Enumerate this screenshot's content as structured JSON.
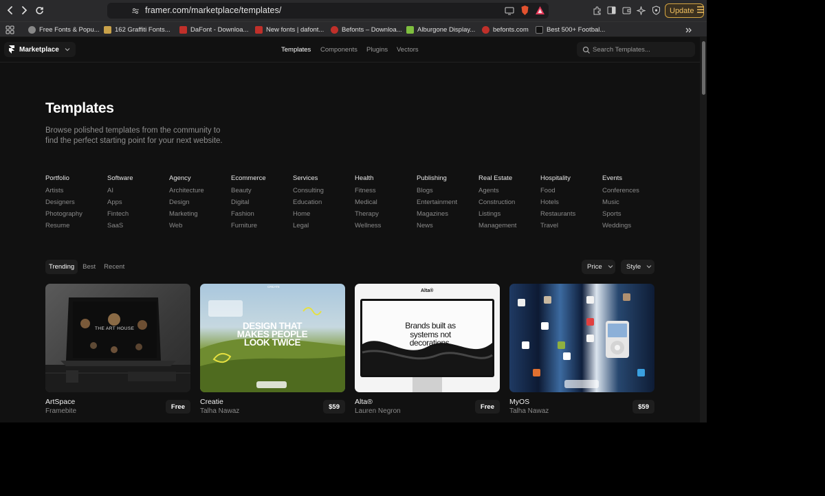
{
  "browser": {
    "url": "framer.com/marketplace/templates/",
    "update_label": "Update",
    "bookmarks": [
      {
        "label": "Free Fonts & Popu...",
        "color": "#888888"
      },
      {
        "label": "162 Graffiti Fonts...",
        "color": "#c9a24a"
      },
      {
        "label": "DaFont - Downloa...",
        "color": "#c0302a"
      },
      {
        "label": "New fonts | dafont...",
        "color": "#c0302a"
      },
      {
        "label": "Befonts – Downloa...",
        "color": "#c0302a"
      },
      {
        "label": "Alburgone Display...",
        "color": "#7fbf3f"
      },
      {
        "label": "befonts.com",
        "color": "#c0302a"
      },
      {
        "label": "Best 500+ Footbal...",
        "color": "#333333"
      }
    ]
  },
  "nav": {
    "brand": "Marketplace",
    "links": [
      "Templates",
      "Components",
      "Plugins",
      "Vectors"
    ],
    "active": "Templates",
    "search_placeholder": "Search Templates..."
  },
  "hero": {
    "title": "Templates",
    "description": "Browse polished templates from the community to find the perfect starting point for your next website."
  },
  "categories": [
    {
      "name": "Portfolio",
      "items": [
        "Artists",
        "Designers",
        "Photography",
        "Resume"
      ]
    },
    {
      "name": "Software",
      "items": [
        "AI",
        "Apps",
        "Fintech",
        "SaaS"
      ]
    },
    {
      "name": "Agency",
      "items": [
        "Architecture",
        "Design",
        "Marketing",
        "Web"
      ]
    },
    {
      "name": "Ecommerce",
      "items": [
        "Beauty",
        "Digital",
        "Fashion",
        "Furniture"
      ]
    },
    {
      "name": "Services",
      "items": [
        "Consulting",
        "Education",
        "Home",
        "Legal"
      ]
    },
    {
      "name": "Health",
      "items": [
        "Fitness",
        "Medical",
        "Therapy",
        "Wellness"
      ]
    },
    {
      "name": "Publishing",
      "items": [
        "Blogs",
        "Entertainment",
        "Magazines",
        "News"
      ]
    },
    {
      "name": "Real Estate",
      "items": [
        "Agents",
        "Construction",
        "Listings",
        "Management"
      ]
    },
    {
      "name": "Hospitality",
      "items": [
        "Food",
        "Hotels",
        "Restaurants",
        "Travel"
      ]
    },
    {
      "name": "Events",
      "items": [
        "Conferences",
        "Music",
        "Sports",
        "Weddings"
      ]
    }
  ],
  "filters": {
    "tabs": [
      "Trending",
      "Best",
      "Recent"
    ],
    "active_tab": "Trending",
    "price_label": "Price",
    "style_label": "Style"
  },
  "templates": [
    {
      "name": "ArtSpace",
      "author": "Framebite",
      "price": "Free",
      "thumb_text": "THE ART HOUSE"
    },
    {
      "name": "Creatie",
      "author": "Talha Nawaz",
      "price": "$59",
      "thumb_text": "DESIGN THAT MAKES PEOPLE LOOK TWICE",
      "thumb_top": "CREATE"
    },
    {
      "name": "Alta®",
      "author": "Lauren Negron",
      "price": "Free",
      "thumb_text": "Brands built as systems not decorations.",
      "thumb_top": "Alta®"
    },
    {
      "name": "MyOS",
      "author": "Talha Nawaz",
      "price": "$59"
    }
  ]
}
